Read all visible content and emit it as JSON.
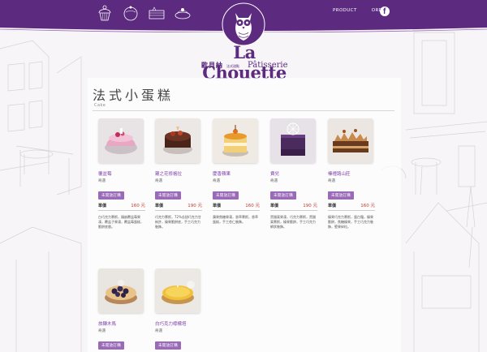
{
  "header": {
    "nav": {
      "product": "PRODUCT",
      "order": "ORDER"
    },
    "icons": [
      "cupcake-icon",
      "cake-icon",
      "layered-cake-icon",
      "tart-icon",
      "facebook-icon"
    ],
    "brand": {
      "name": "La Chouette",
      "cn": "歐貝納",
      "cn_small": "法式甜點",
      "patisserie": "Pâtisserie"
    }
  },
  "page": {
    "title": "法式小蛋糕",
    "subtitle": "Cake"
  },
  "colors": {
    "brand_purple": "#5c2a7e",
    "button_purple": "#9a6ab8",
    "price_red": "#c0392b"
  },
  "products": [
    {
      "name": "覆盆莓",
      "desc": "奇遇",
      "button": "未開放訂購",
      "price_label": "單價",
      "price": "160 元",
      "intro": "白巧克力慕斯，鑲嵌覆盆莓果凍，覆盆子果凍，覆盆莓蛋糕，脆餅底層。"
    },
    {
      "name": "蘿之花修格拉",
      "desc": "奇遇",
      "button": "未開放訂購",
      "price_label": "單價",
      "price": "190 元",
      "intro": "巧克力慕斯，72%苦甜巧克力甘納許，榛果脆餅底，手工巧克力裝飾。"
    },
    {
      "name": "慶香蘋果",
      "desc": "奇遇",
      "button": "未開放訂購",
      "price_label": "單價",
      "price": "160 元",
      "intro": "蘋果焦糖果凍，香草慕斯，香草蛋糕，手工杏仁裝飾。"
    },
    {
      "name": "費兒",
      "desc": "奇遇",
      "button": "未開放訂購",
      "price_label": "單價",
      "price": "190 元",
      "intro": "黑醋栗果凍，巧克力慕斯，黑醋栗慕斯，榛果脆餅，手工巧克力網狀裝飾。"
    },
    {
      "name": "榛禮路山莊",
      "desc": "奇遇",
      "button": "未開放訂購",
      "price_label": "單價",
      "price": "160 元",
      "intro": "榛果巧克力慕斯，蛋白霜，榛果脆餅，焦糖榛果，手工巧克力裝飾，堅果碎粒。"
    },
    {
      "name": "旅轉木馬",
      "desc": "奇遇",
      "button": "未開放訂購"
    },
    {
      "name": "白巧克力檸檬塔",
      "desc": "奇遇",
      "button": "未開放訂購"
    }
  ]
}
